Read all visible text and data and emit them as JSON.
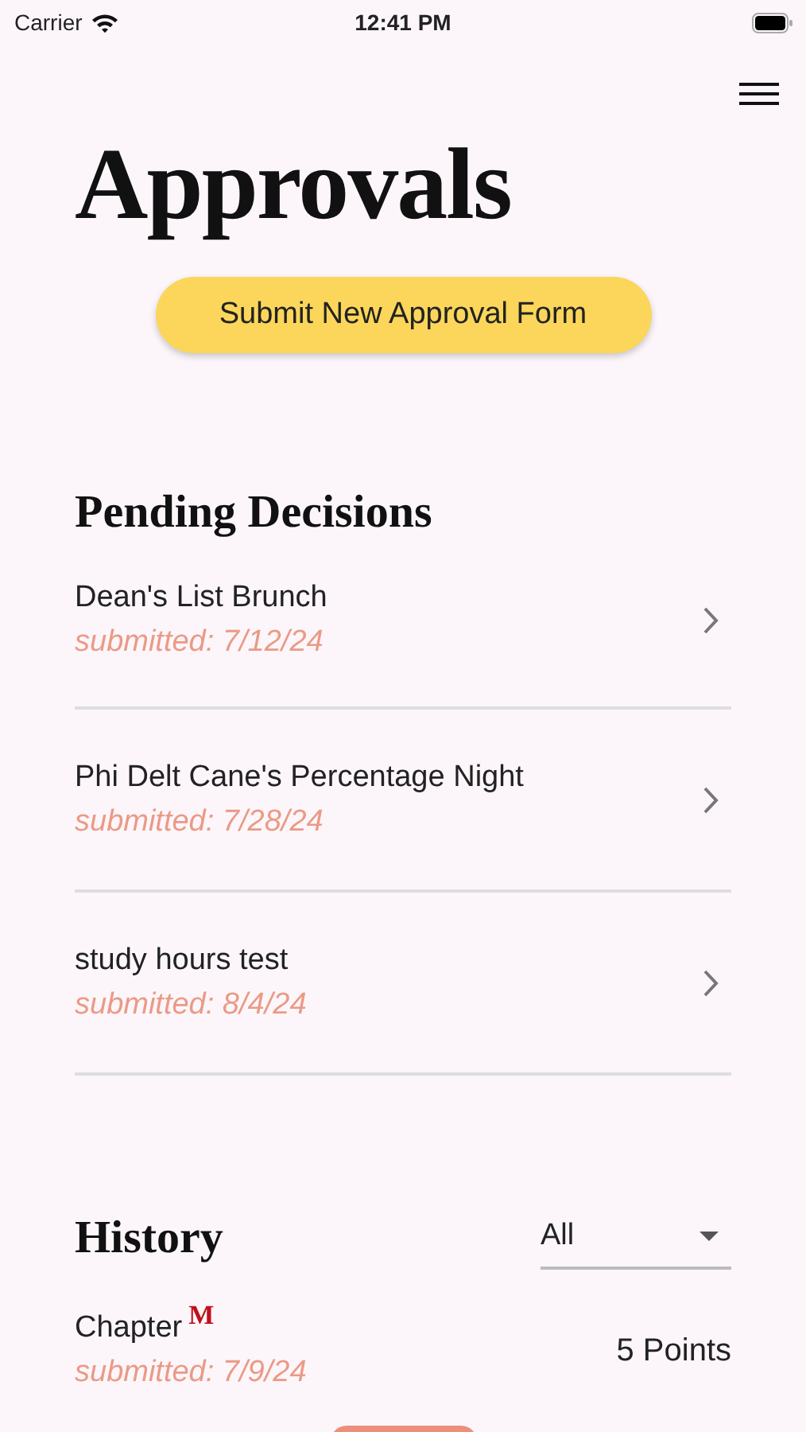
{
  "status_bar": {
    "carrier": "Carrier",
    "time": "12:41 PM"
  },
  "title": "Approvals",
  "submit_button": "Submit New Approval Form",
  "pending": {
    "heading": "Pending Decisions",
    "items": [
      {
        "name": "Dean's List Brunch",
        "submitted": "submitted: 7/12/24"
      },
      {
        "name": "Phi Delt Cane's Percentage Night",
        "submitted": "submitted: 7/28/24"
      },
      {
        "name": "study hours test",
        "submitted": "submitted: 8/4/24"
      }
    ]
  },
  "history": {
    "heading": "History",
    "filter": "All",
    "items": [
      {
        "name": "Chapter",
        "badge": "M",
        "submitted": "submitted: 7/9/24",
        "points": "5 Points"
      }
    ]
  }
}
